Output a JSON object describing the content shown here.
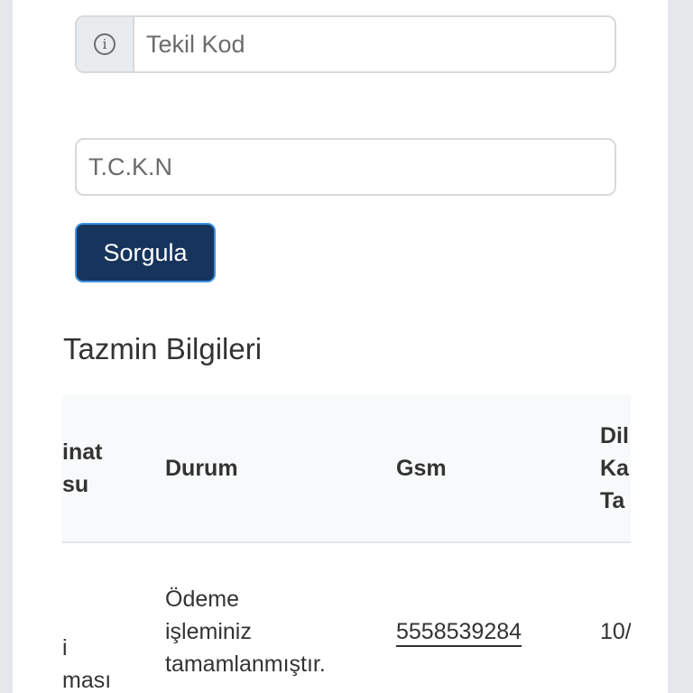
{
  "form": {
    "tekil_kod_placeholder": "Tekil Kod",
    "tckn_placeholder": "T.C.K.N",
    "submit_label": "Sorgula"
  },
  "section": {
    "title": "Tazmin Bilgileri"
  },
  "table": {
    "headers": {
      "teminat_line1": "inat",
      "teminat_line2": "su",
      "durum": "Durum",
      "gsm": "Gsm",
      "next_line1": "Dil",
      "next_line2": "Ka",
      "next_line3": "Ta"
    },
    "row": {
      "teminat_line1": "i",
      "teminat_line2": "ması",
      "durum_line1": "Ödeme",
      "durum_line2": "işleminiz",
      "durum_line3": "tamamlanmıştır.",
      "gsm": "5558539284",
      "next": "10/"
    }
  }
}
